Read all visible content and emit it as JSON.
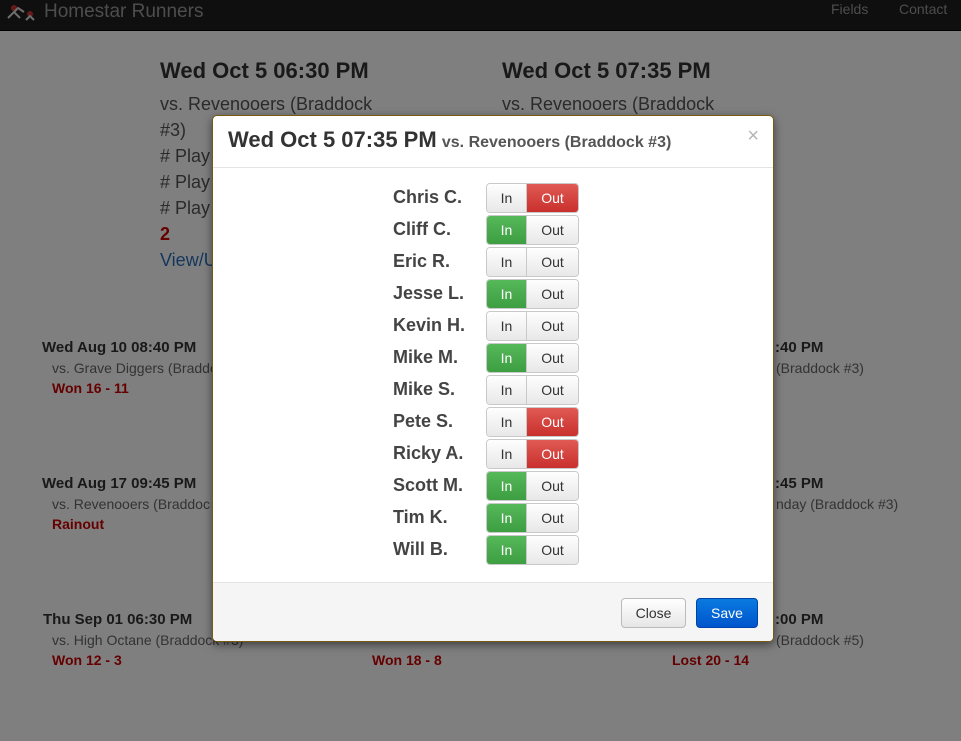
{
  "navbar": {
    "brand": "Homestar Runners",
    "links": [
      "Fields",
      "Contact"
    ]
  },
  "upcoming": [
    {
      "title": "Wed Oct 5 06:30 PM",
      "opponent": "vs. Revenooers (Braddock #3)",
      "lines": [
        "# Play",
        "# Play",
        "# Play"
      ],
      "count": "2",
      "link": "View/U"
    },
    {
      "title": "Wed Oct 5 07:35 PM",
      "opponent": "vs. Revenooers (Braddock"
    }
  ],
  "games": [
    {
      "date": "Wed Aug 10 08:40 PM",
      "opponent": "vs. Grave Diggers (Braddo",
      "result": "Won 16 - 11"
    },
    {
      "date": ":40 PM",
      "opponent": "(Braddock #3)",
      "result": ""
    },
    {
      "date": "Wed Aug 17 09:45 PM",
      "opponent": "vs. Revenooers (Braddoc",
      "result": "Rainout"
    },
    {
      "date": ":45 PM",
      "opponent": "nday (Braddock #3)",
      "result": ""
    },
    {
      "date": "Thu Sep 01 06:30 PM",
      "opponent": "vs. High Octane (Braddock #3)",
      "result": "Won 12 - 3"
    },
    {
      "date": "",
      "opponent": "",
      "result": "Won 18 - 8"
    },
    {
      "date": ":00 PM",
      "opponent": "(Braddock #5)",
      "result": "Lost 20 - 14"
    }
  ],
  "modal": {
    "title": "Wed Oct 5 07:35 PM",
    "subtitle": "vs. Revenooers (Braddock #3)",
    "close_symbol": "×",
    "in_label": "In",
    "out_label": "Out",
    "players": [
      {
        "name": "Chris C.",
        "status": "out"
      },
      {
        "name": "Cliff C.",
        "status": "in"
      },
      {
        "name": "Eric R.",
        "status": "none"
      },
      {
        "name": "Jesse L.",
        "status": "in"
      },
      {
        "name": "Kevin H.",
        "status": "none"
      },
      {
        "name": "Mike M.",
        "status": "in"
      },
      {
        "name": "Mike S.",
        "status": "none"
      },
      {
        "name": "Pete S.",
        "status": "out"
      },
      {
        "name": "Ricky A.",
        "status": "out"
      },
      {
        "name": "Scott M.",
        "status": "in"
      },
      {
        "name": "Tim K.",
        "status": "in"
      },
      {
        "name": "Will B.",
        "status": "in"
      }
    ],
    "close_button": "Close",
    "save_button": "Save"
  },
  "colors": {
    "in_active": "#47a447",
    "out_active": "#d2322d",
    "save": "#0066cc",
    "result": "#cc0000"
  }
}
